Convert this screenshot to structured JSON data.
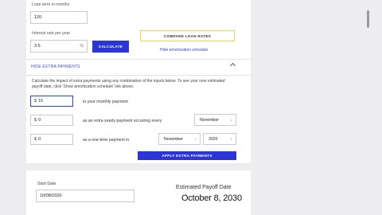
{
  "loan_form": {
    "loan_term_label": "Loan term in months",
    "loan_term_value": "120",
    "interest_label": "Interest rate per year",
    "interest_value": "3.5",
    "interest_suffix": "%",
    "calculate_label": "CALCULATE"
  },
  "compare": {
    "compare_label": "COMPARE LOAN RATES",
    "hide_schedule_label": "Hide amortization schedule"
  },
  "extra_payments": {
    "toggle_label": "HIDE EXTRA PAYMENTS",
    "toggle_icon": "chevron-up-icon",
    "description": "Calculate the impact of extra payments using any combination of the inputs below. To see your new estimated payoff date, click 'Show amortization schedule' link above.",
    "currency": "$",
    "monthly_value": "15",
    "monthly_label": "to your monthly payment",
    "yearly_value": "0",
    "yearly_label": "as an extra yearly payment occurring every",
    "yearly_month": "November",
    "onetime_value": "0",
    "onetime_label": "as a one-time payment in",
    "onetime_month": "November",
    "onetime_year": "2020",
    "apply_label": "APPLY EXTRA PAYMENTS",
    "accent_color": "#2c35d8"
  },
  "summary": {
    "start_date_label": "Start Date",
    "start_date_value": "10/08/2020",
    "payoff_label": "Estimated Payoff Date",
    "payoff_value": "October 8, 2030"
  }
}
